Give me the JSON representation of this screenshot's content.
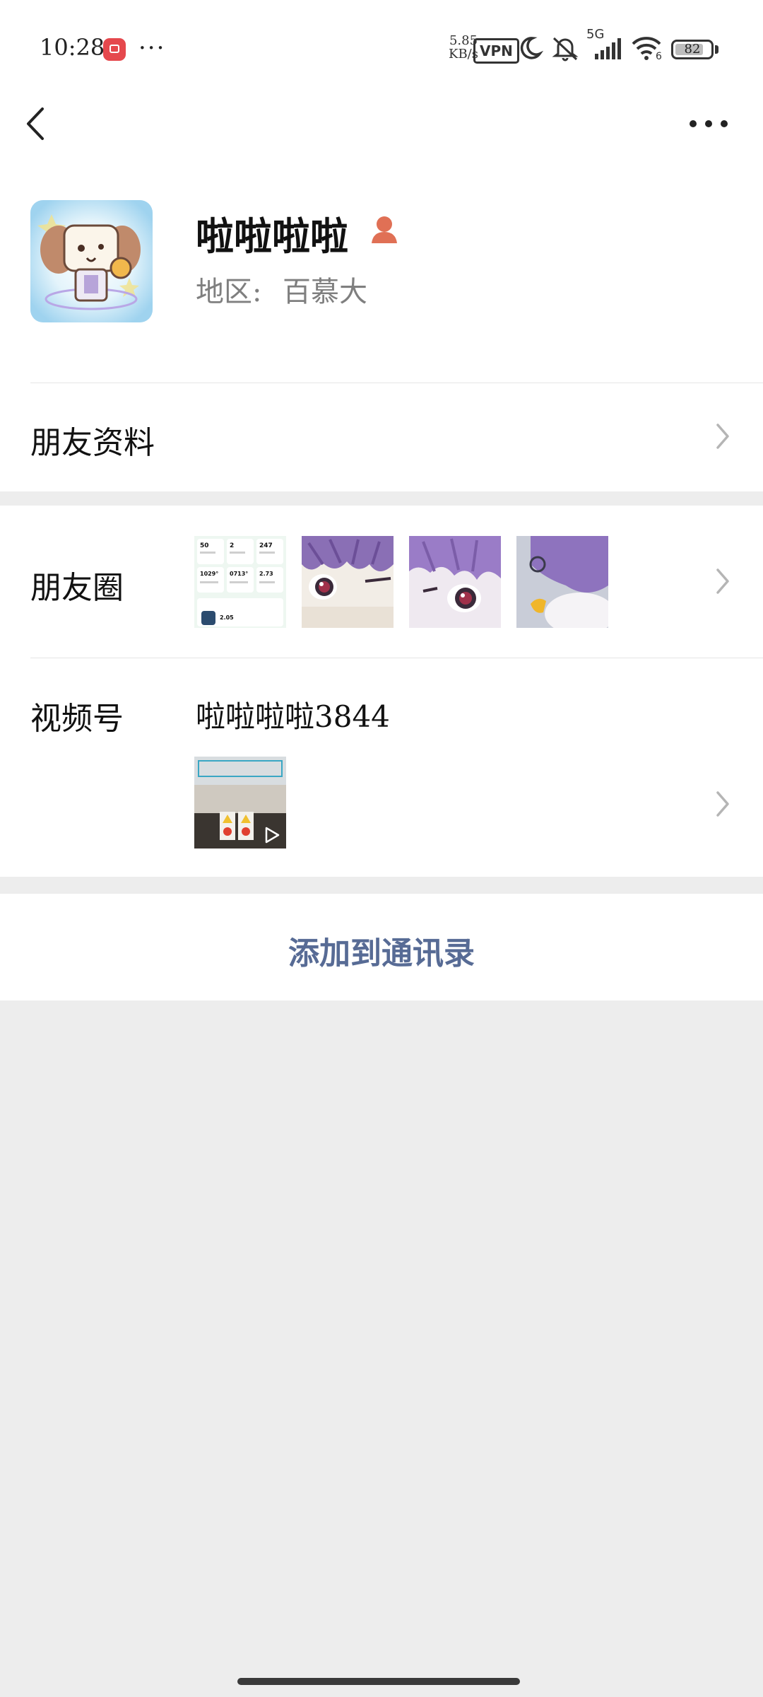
{
  "status_bar": {
    "time": "10:28",
    "more": "···",
    "net_speed": "5.85",
    "net_speed_unit": "KB/s",
    "vpn": "VPN",
    "signal_type": "5G",
    "wifi_sub": "6",
    "battery": "82",
    "icons": [
      "app-notification-icon",
      "moon-icon",
      "mute-icon",
      "signal-icon",
      "wifi-icon",
      "battery-icon"
    ]
  },
  "nav": {
    "back_icon": "chevron-left-icon",
    "more_icon": "more-dots-icon"
  },
  "profile": {
    "name": "啦啦啦啦",
    "region_label": "地区:",
    "region_value": "百慕大",
    "badge_icon": "person-badge-icon",
    "badge_color": "#e07055"
  },
  "rows": {
    "friend_info": "朋友资料",
    "moments": "朋友圈",
    "channels": "视频号",
    "channel_name": "啦啦啦啦3844"
  },
  "actions": {
    "add_contact": "添加到通讯录",
    "add_contact_color": "#576b95"
  },
  "moments_thumbs": [
    {
      "stats": [
        "50",
        "2",
        "247",
        "1029°",
        "0713°",
        "2.73",
        "2.05"
      ]
    },
    {},
    {},
    {}
  ]
}
